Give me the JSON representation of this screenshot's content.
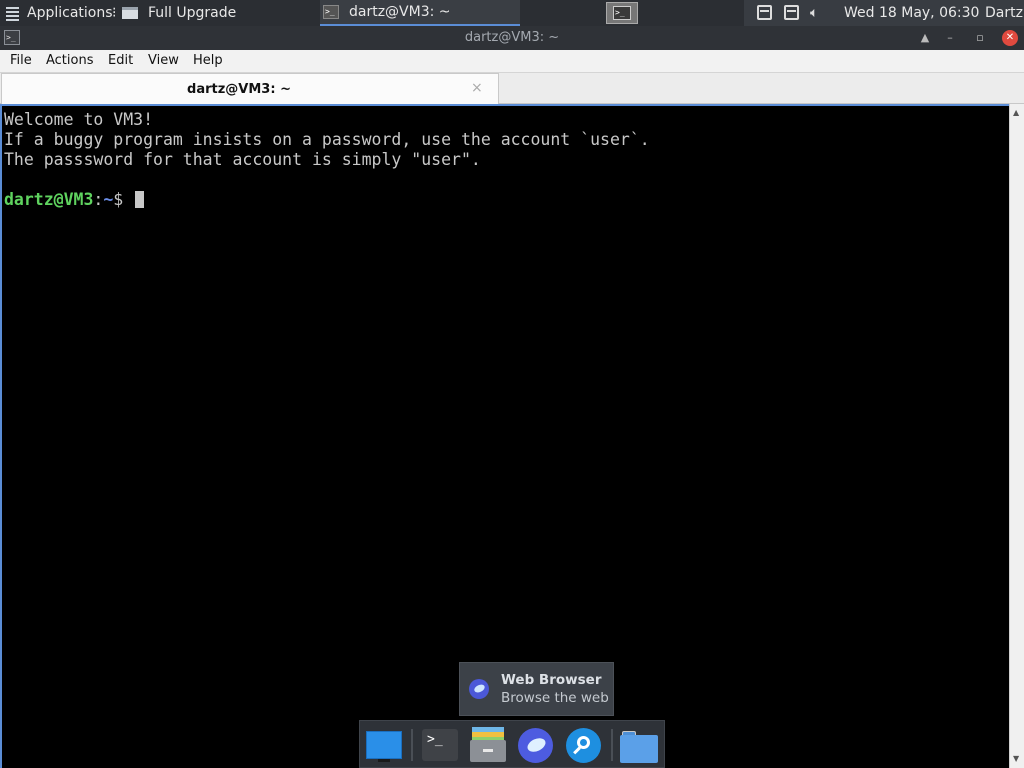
{
  "panel": {
    "applications_label": "Applications",
    "dots": "⁝",
    "task_upgrade_label": "Full Upgrade",
    "task_terminal_label": "dartz@VM3: ~",
    "workspace_glyph": ">_",
    "clock": "Wed 18 May, 06:30",
    "user": "Dartz"
  },
  "window": {
    "title": "dartz@VM3: ~",
    "icon_glyph": ">_",
    "controls": {
      "shade": "▲",
      "minimize": "–",
      "maximize": "▫",
      "close": "✕"
    }
  },
  "menubar": {
    "items": [
      "File",
      "Actions",
      "Edit",
      "View",
      "Help"
    ]
  },
  "tabs": [
    {
      "label": "dartz@VM3: ~",
      "close": "×"
    }
  ],
  "terminal": {
    "lines": [
      "Welcome to VM3!",
      "If a buggy program insists on a password, use the account `user`.",
      "The passsword for that account is simply \"user\"."
    ],
    "prompt": {
      "user_host": "dartz@VM3",
      "colon": ":",
      "path": "~",
      "symbol": "$ "
    }
  },
  "scrollbar": {
    "up": "▲",
    "down": "▼"
  },
  "tooltip": {
    "title": "Web Browser",
    "subtitle": "Browse the web"
  },
  "dock": {
    "terminal_glyph": ">_",
    "items": [
      "show-desktop",
      "terminal",
      "file-manager",
      "web-browser",
      "app-finder",
      "home-folder"
    ]
  },
  "colors": {
    "panel_bg": "#2b2e33",
    "accent": "#5b8dd6",
    "prompt_user": "#5fd35f",
    "prompt_path": "#6a8de6",
    "terminal_bg": "#000000",
    "terminal_fg": "#c8c8c8"
  }
}
